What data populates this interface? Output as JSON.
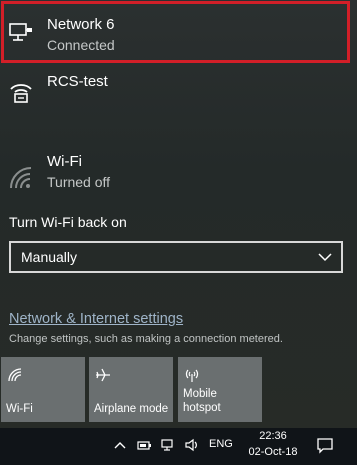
{
  "networks": [
    {
      "name": "Network 6",
      "status": "Connected",
      "icon": "ethernet-icon"
    },
    {
      "name": "RCS-test",
      "status": "",
      "icon": "dialup-icon"
    }
  ],
  "wifi": {
    "name": "Wi-Fi",
    "status": "Turned off",
    "icon": "wifi-off-icon"
  },
  "turn_wifi_back_on": {
    "label": "Turn Wi-Fi back on",
    "selected": "Manually"
  },
  "settings": {
    "link": "Network & Internet settings",
    "description": "Change settings, such as making a connection metered."
  },
  "quick_actions": [
    {
      "label": "Wi-Fi",
      "icon": "wifi-icon"
    },
    {
      "label": "Airplane mode",
      "icon": "airplane-icon"
    },
    {
      "label_line1": "Mobile",
      "label_line2": "hotspot",
      "icon": "hotspot-icon"
    }
  ],
  "taskbar": {
    "language": "ENG",
    "time": "22:36",
    "date": "02-Oct-18",
    "icons": [
      "chevron-up-icon",
      "battery-icon",
      "network-icon",
      "volume-icon",
      "notification-icon"
    ]
  },
  "colors": {
    "highlight": "#d21f28",
    "tile": "#6a6f70",
    "link": "#9fb4c8",
    "taskbar": "#101418"
  }
}
